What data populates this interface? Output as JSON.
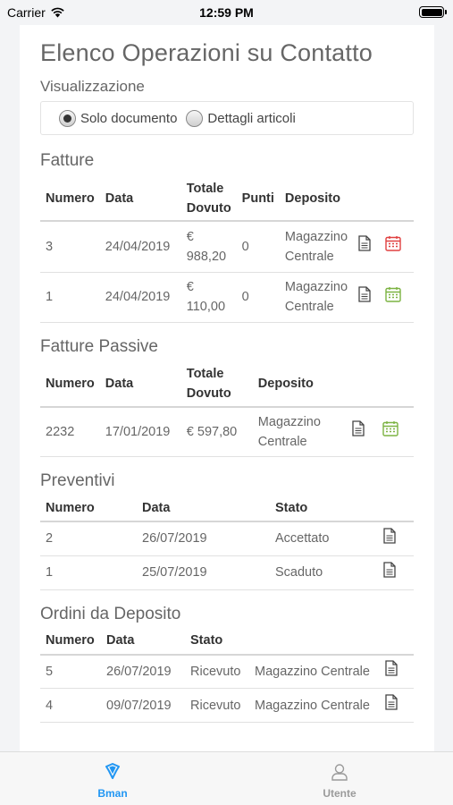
{
  "status": {
    "carrier": "Carrier",
    "time": "12:59 PM",
    "battery_level": 1.0
  },
  "page_title": "Elenco Operazioni su Contatto",
  "visualizzazione": {
    "label": "Visualizzazione",
    "options": [
      {
        "label": "Solo documento",
        "selected": true
      },
      {
        "label": "Dettagli articoli",
        "selected": false
      }
    ]
  },
  "fatture": {
    "title": "Fatture",
    "headers": [
      "Numero",
      "Data",
      "Totale Dovuto",
      "Punti",
      "Deposito"
    ],
    "rows": [
      {
        "numero": "3",
        "data": "24/04/2019",
        "totale": "€ 988,20",
        "punti": "0",
        "deposito": "Magazzino Centrale",
        "calendar_color": "#e04040"
      },
      {
        "numero": "1",
        "data": "24/04/2019",
        "totale": "€ 110,00",
        "punti": "0",
        "deposito": "Magazzino Centrale",
        "calendar_color": "#7cb342"
      }
    ]
  },
  "fatture_passive": {
    "title": "Fatture Passive",
    "headers": [
      "Numero",
      "Data",
      "Totale Dovuto",
      "Deposito"
    ],
    "rows": [
      {
        "numero": "2232",
        "data": "17/01/2019",
        "totale": "€ 597,80",
        "deposito": "Magazzino Centrale",
        "calendar_color": "#7cb342"
      }
    ]
  },
  "preventivi": {
    "title": "Preventivi",
    "headers": [
      "Numero",
      "Data",
      "Stato"
    ],
    "rows": [
      {
        "numero": "2",
        "data": "26/07/2019",
        "stato": "Accettato"
      },
      {
        "numero": "1",
        "data": "25/07/2019",
        "stato": "Scaduto"
      }
    ]
  },
  "ordini": {
    "title": "Ordini da Deposito",
    "headers": [
      "Numero",
      "Data",
      "Stato"
    ],
    "rows": [
      {
        "numero": "5",
        "data": "26/07/2019",
        "stato": "Ricevuto",
        "deposito": "Magazzino Centrale"
      },
      {
        "numero": "4",
        "data": "09/07/2019",
        "stato": "Ricevuto",
        "deposito": "Magazzino Centrale"
      }
    ]
  },
  "tabbar": {
    "active_color": "#2196f3",
    "inactive_color": "#9a9a9a",
    "tabs": [
      {
        "label": "Bman",
        "icon": "bman-logo-icon",
        "active": true
      },
      {
        "label": "Utente",
        "icon": "user-icon",
        "active": false
      }
    ]
  }
}
